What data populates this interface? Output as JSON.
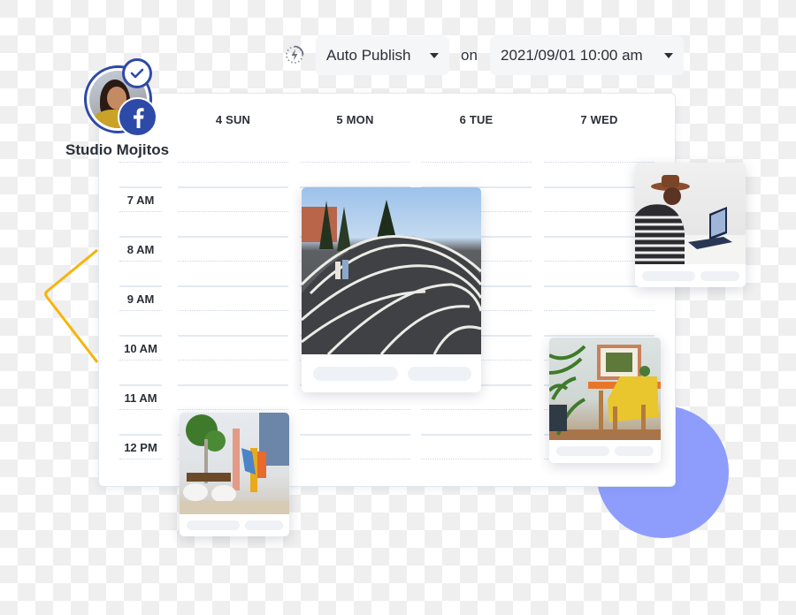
{
  "toolbar": {
    "publish_icon": "auto-publish-bolt-icon",
    "publish_mode": "Auto Publish",
    "on_label": "on",
    "datetime": "2021/09/01 10:00 am"
  },
  "account": {
    "name": "Studio Mojitos",
    "network": "facebook",
    "verified": true,
    "fb_glyph": "f"
  },
  "calendar": {
    "days": [
      "4 SUN",
      "5 MON",
      "6 TUE",
      "7 WED"
    ],
    "times": [
      "7 AM",
      "8 AM",
      "9 AM",
      "10 AM",
      "11 AM",
      "12 PM"
    ]
  },
  "posts": [
    {
      "day": "5 MON",
      "image": "striped-hill-park-photo"
    },
    {
      "day": "4 SUN",
      "image": "office-lobby-chess-photo"
    },
    {
      "day": "7 WED",
      "image": "man-with-hat-laptop-photo"
    },
    {
      "day": "7 WED",
      "image": "yellow-armchair-photo"
    }
  ],
  "colors": {
    "brand_blue": "#2e4aa8",
    "accent_circle": "#8e9dfb",
    "accent_line": "#f5b50a",
    "text": "#2b2f36"
  }
}
